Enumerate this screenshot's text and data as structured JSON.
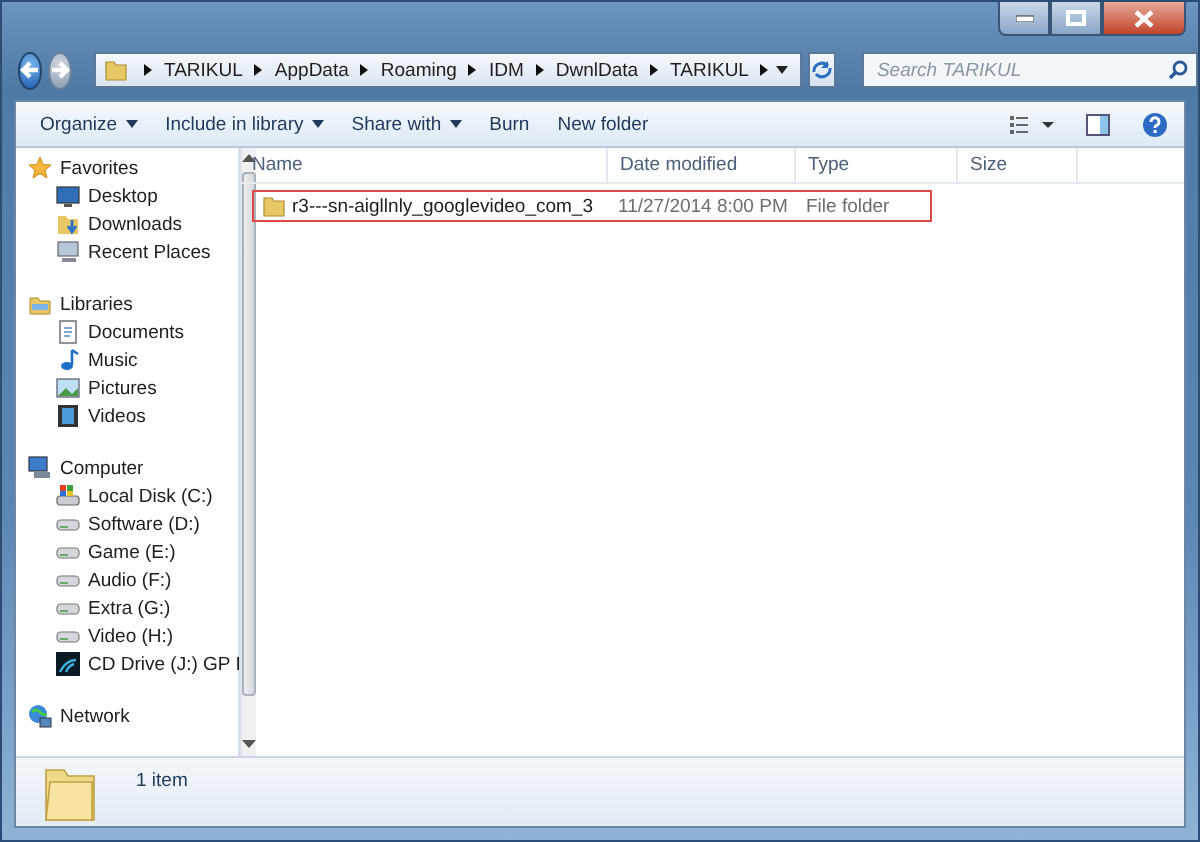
{
  "address_bar": {
    "segments": [
      "TARIKUL",
      "AppData",
      "Roaming",
      "IDM",
      "DwnlData",
      "TARIKUL"
    ]
  },
  "search": {
    "placeholder": "Search TARIKUL"
  },
  "toolbar": {
    "buttons": [
      {
        "label": "Organize",
        "dropdown": true
      },
      {
        "label": "Include in library",
        "dropdown": true
      },
      {
        "label": "Share with",
        "dropdown": true
      },
      {
        "label": "Burn",
        "dropdown": false
      },
      {
        "label": "New folder",
        "dropdown": false
      }
    ]
  },
  "navigation": {
    "groups": [
      {
        "label": "Favorites",
        "kind": "favorites",
        "items": [
          {
            "label": "Desktop",
            "kind": "desktop"
          },
          {
            "label": "Downloads",
            "kind": "downloads"
          },
          {
            "label": "Recent Places",
            "kind": "recent"
          }
        ]
      },
      {
        "label": "Libraries",
        "kind": "libraries",
        "items": [
          {
            "label": "Documents",
            "kind": "documents"
          },
          {
            "label": "Music",
            "kind": "music"
          },
          {
            "label": "Pictures",
            "kind": "pictures"
          },
          {
            "label": "Videos",
            "kind": "videos"
          }
        ]
      },
      {
        "label": "Computer",
        "kind": "computer",
        "items": [
          {
            "label": "Local Disk (C:)",
            "kind": "systemdisk"
          },
          {
            "label": "Software (D:)",
            "kind": "disk"
          },
          {
            "label": "Game (E:)",
            "kind": "disk"
          },
          {
            "label": "Audio (F:)",
            "kind": "disk"
          },
          {
            "label": "Extra (G:)",
            "kind": "disk"
          },
          {
            "label": "Video (H:)",
            "kind": "disk"
          },
          {
            "label": "CD Drive (J:) GP I",
            "kind": "modem"
          }
        ]
      },
      {
        "label": "Network",
        "kind": "network"
      }
    ]
  },
  "file_list": {
    "columns": [
      "Name",
      "Date modified",
      "Type",
      "Size"
    ],
    "rows": [
      {
        "name": "r3---sn-aigllnly_googlevideo_com_3",
        "date": "11/27/2014 8:00 PM",
        "type": "File folder",
        "highlighted": true
      }
    ]
  },
  "status_bar": {
    "count": "1 item"
  }
}
